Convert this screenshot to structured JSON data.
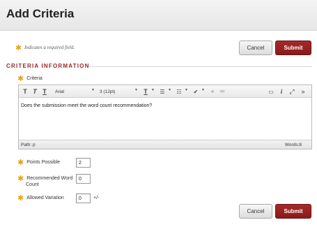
{
  "header": {
    "title": "Add Criteria"
  },
  "required_note": {
    "star": "✱",
    "text": "Indicates a required field."
  },
  "top_buttons": {
    "cancel": "Cancel",
    "submit": "Submit"
  },
  "section": {
    "title": "CRITERIA INFORMATION"
  },
  "criteria": {
    "label": "Criteria",
    "toolbar": {
      "bold": "T",
      "italic": "T",
      "underline": "T",
      "font_family": "Arial",
      "font_size": "3 (12pt)"
    },
    "content": "Does the submission meet the word count recommendation?",
    "path": "Path: p",
    "words": "Words:8"
  },
  "fields": [
    {
      "label": "Points Possible",
      "value": "2"
    },
    {
      "label_line1": "Recommended Word",
      "label_line2": "Count",
      "value": "0"
    },
    {
      "label": "Allowed Variation",
      "value": "0",
      "suffix": "+/-"
    }
  ],
  "bottom_buttons": {
    "cancel": "Cancel",
    "submit": "Submit"
  },
  "colors": {
    "accent": "#9b2323",
    "required": "#e8a317"
  }
}
